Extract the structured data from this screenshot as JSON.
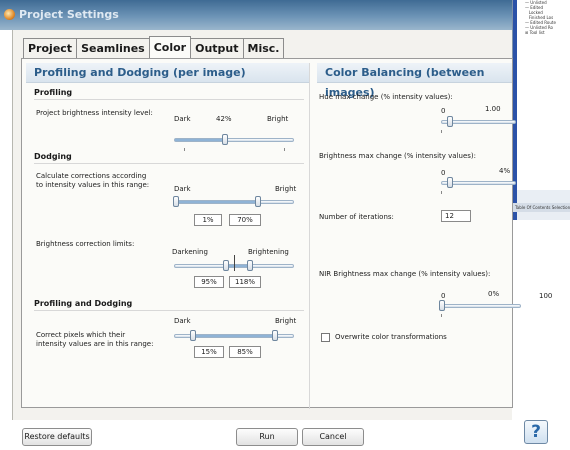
{
  "window": {
    "title": "Project Settings",
    "icon": "app-icon"
  },
  "background_window": {
    "tree_text": "— Unlisted\n— Edited\n   Locked\n   Finished Los\n— Edited Route\n— Unlisted Ro\n⊞ Tool list",
    "tabs_text": "Table Of Contents  Selection"
  },
  "tabs": [
    {
      "label": "Project",
      "active": false
    },
    {
      "label": "Seamlines",
      "active": false
    },
    {
      "label": "Color",
      "active": true
    },
    {
      "label": "Output",
      "active": false
    },
    {
      "label": "Misc.",
      "active": false
    }
  ],
  "left": {
    "header": "Profiling and Dodging (per image)",
    "profiling": {
      "title": "Profiling",
      "label": "Project brightness intensity level:",
      "min_label": "Dark",
      "max_label": "Bright",
      "value_label": "42%",
      "value": 42
    },
    "dodging": {
      "title": "Dodging",
      "range_label": "Calculate corrections according\nto intensity values in this range:",
      "range_min_label": "Dark",
      "range_max_label": "Bright",
      "range_low": "1%",
      "range_high": "70%",
      "range_low_value": 1,
      "range_high_value": 70,
      "limits_label": "Brightness correction limits:",
      "limits_min_label": "Darkening",
      "limits_max_label": "Brightening",
      "limits_low": "95%",
      "limits_high": "118%"
    },
    "profiling_dodging": {
      "title": "Profiling and Dodging",
      "label": "Correct pixels which their\nintensity values are in this range:",
      "min_label": "Dark",
      "max_label": "Bright",
      "low": "15%",
      "high": "85%",
      "low_value": 15,
      "high_value": 85
    }
  },
  "right": {
    "header": "Color Balancing (between images)",
    "hue": {
      "label": "Hue max change (% intensity values):",
      "min": "0",
      "value_label": "1.00"
    },
    "brightness": {
      "label": "Brightness max change (% intensity values):",
      "min": "0",
      "value_label": "4%"
    },
    "iterations": {
      "label": "Number of iterations:",
      "value": "12"
    },
    "nir": {
      "label": "NIR Brightness max change (% intensity values):",
      "min": "0",
      "value_label": "0%",
      "max": "100"
    },
    "overwrite": {
      "label": "Overwrite color transformations",
      "checked": false
    }
  },
  "footer": {
    "restore_label": "Restore defaults",
    "run_label": "Run",
    "cancel_label": "Cancel",
    "help_label": "?"
  },
  "colors": {
    "title_bar": "#4f7aa3",
    "section_header_text": "#2c5d8a",
    "slider_fill": "#8fb3d6"
  }
}
